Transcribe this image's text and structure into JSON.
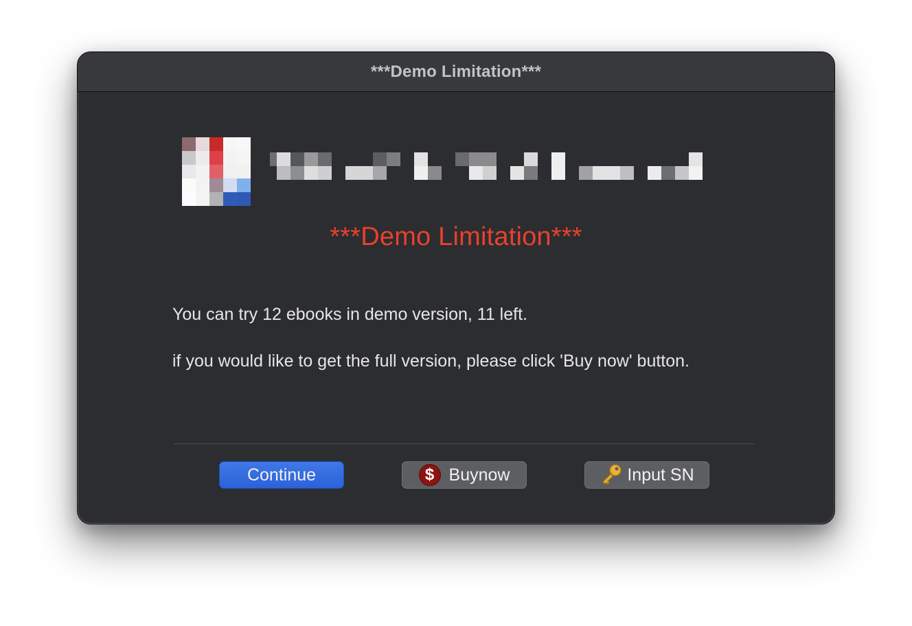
{
  "window": {
    "title": "***Demo Limitation***"
  },
  "content": {
    "headline": "***Demo Limitation***",
    "message_1": "You can try 12 ebooks in demo version, 11 left.",
    "message_2": "if you would like to get the full version, please click 'Buy now' button."
  },
  "buttons": {
    "continue_label": "Continue",
    "buy_label": "Buynow",
    "input_sn_label": "Input SN"
  },
  "icons": {
    "app": "app-icon-pixelated",
    "buy": "dollar-icon",
    "input_sn": "key-icon"
  },
  "colors": {
    "headline": "#e8412c",
    "primary_button": "#2c62d9",
    "window_bg": "#2c2d30"
  }
}
